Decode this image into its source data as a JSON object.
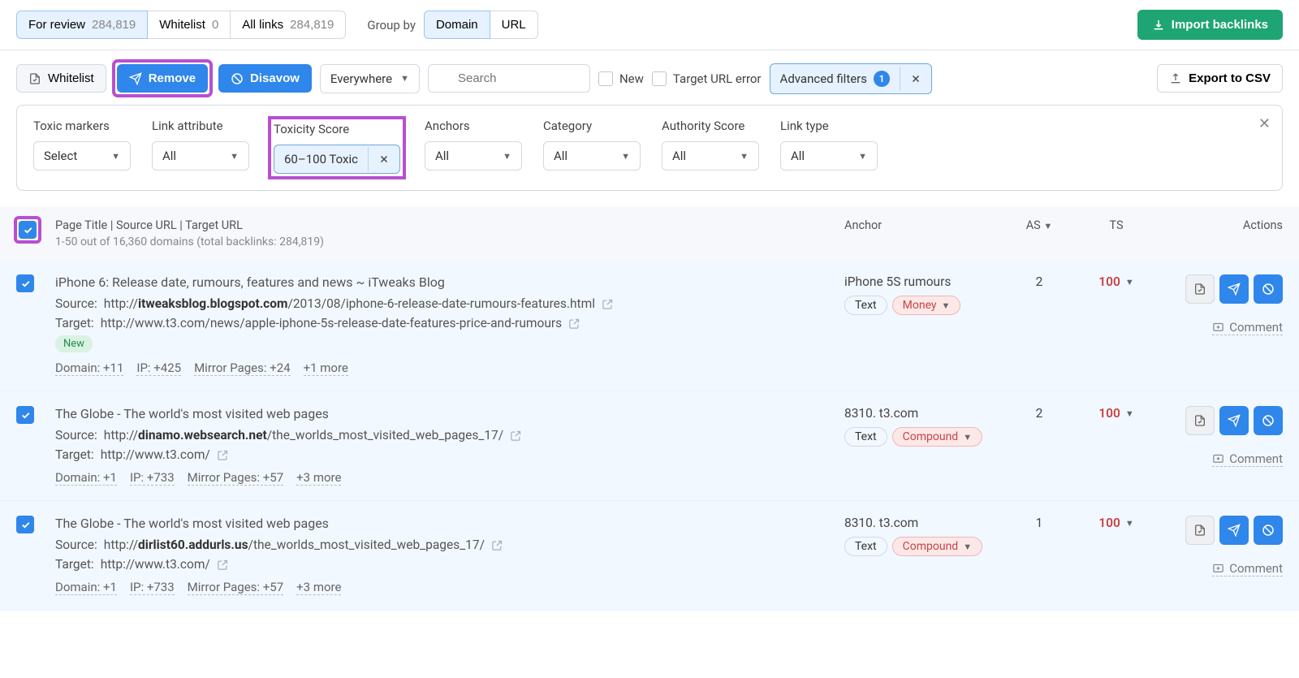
{
  "topTabs": {
    "forReview": {
      "label": "For review",
      "count": "284,819"
    },
    "whitelist": {
      "label": "Whitelist",
      "count": "0"
    },
    "allLinks": {
      "label": "All links",
      "count": "284,819"
    }
  },
  "groupBy": {
    "label": "Group by",
    "domain": "Domain",
    "url": "URL"
  },
  "importButton": "Import backlinks",
  "toolbar": {
    "whitelist": "Whitelist",
    "remove": "Remove",
    "disavow": "Disavow",
    "everywhere": "Everywhere",
    "searchPlaceholder": "Search",
    "new": "New",
    "targetUrlError": "Target URL error",
    "advancedFilters": "Advanced filters",
    "advancedBadge": "1",
    "export": "Export to CSV"
  },
  "filters": {
    "toxicMarkers": {
      "label": "Toxic markers",
      "value": "Select"
    },
    "linkAttribute": {
      "label": "Link attribute",
      "value": "All"
    },
    "toxicityScore": {
      "label": "Toxicity Score",
      "value": "60–100 Toxic"
    },
    "anchors": {
      "label": "Anchors",
      "value": "All"
    },
    "category": {
      "label": "Category",
      "value": "All"
    },
    "authorityScore": {
      "label": "Authority Score",
      "value": "All"
    },
    "linkType": {
      "label": "Link type",
      "value": "All"
    }
  },
  "tableHeader": {
    "main": "Page Title | Source URL | Target URL",
    "sub": "1-50 out of 16,360 domains (total backlinks: 284,819)",
    "anchor": "Anchor",
    "as": "AS",
    "ts": "TS",
    "actions": "Actions"
  },
  "rows": [
    {
      "title": "iPhone 6: Release date, rumours, features and news ~ iTweaks Blog",
      "sourcePrefix": "Source:",
      "sourceA": "http://",
      "sourceBold": "itweaksblog.blogspot.com",
      "sourceB": "/2013/08/iphone-6-release-date-rumours-features.html",
      "targetPrefix": "Target:",
      "target": "http://www.t3.com/news/apple-iphone-5s-release-date-features-price-and-rumours",
      "newBadge": "New",
      "meta": [
        "Domain: +11",
        "IP: +425",
        "Mirror Pages: +24",
        "+1 more"
      ],
      "anchor": "iPhone 5S rumours",
      "anchorBadges": [
        {
          "text": "Text",
          "type": "plain"
        },
        {
          "text": "Money",
          "type": "money",
          "chev": true
        }
      ],
      "as": "2",
      "ts": "100",
      "comment": "Comment"
    },
    {
      "title": "The Globe - The world's most visited web pages",
      "sourcePrefix": "Source:",
      "sourceA": "http://",
      "sourceBold": "dinamo.websearch.net",
      "sourceB": "/the_worlds_most_visited_web_pages_17/",
      "targetPrefix": "Target:",
      "target": "http://www.t3.com/",
      "meta": [
        "Domain: +1",
        "IP: +733",
        "Mirror Pages: +57",
        "+3 more"
      ],
      "anchor": "8310. t3.com",
      "anchorBadges": [
        {
          "text": "Text",
          "type": "plain"
        },
        {
          "text": "Compound",
          "type": "compound",
          "chev": true
        }
      ],
      "as": "2",
      "ts": "100",
      "comment": "Comment"
    },
    {
      "title": "The Globe - The world's most visited web pages",
      "sourcePrefix": "Source:",
      "sourceA": "http://",
      "sourceBold": "dirlist60.addurls.us",
      "sourceB": "/the_worlds_most_visited_web_pages_17/",
      "targetPrefix": "Target:",
      "target": "http://www.t3.com/",
      "meta": [
        "Domain: +1",
        "IP: +733",
        "Mirror Pages: +57",
        "+3 more"
      ],
      "anchor": "8310. t3.com",
      "anchorBadges": [
        {
          "text": "Text",
          "type": "plain"
        },
        {
          "text": "Compound",
          "type": "compound",
          "chev": true
        }
      ],
      "as": "1",
      "ts": "100",
      "comment": "Comment"
    }
  ]
}
